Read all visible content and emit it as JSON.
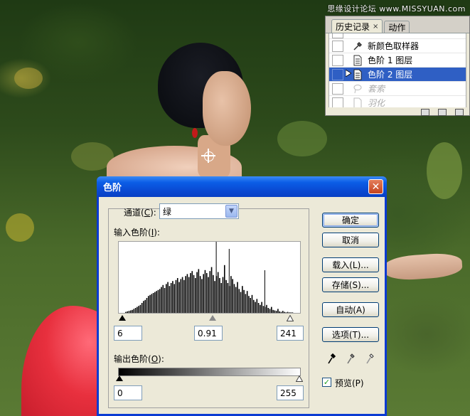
{
  "watermark": "思缘设计论坛 www.MISSYUAN.com",
  "history_panel": {
    "tabs": [
      {
        "label": "历史记录",
        "close": "×"
      },
      {
        "label": "动作"
      }
    ],
    "items": [
      {
        "label": "新颜色取样器"
      },
      {
        "label": "色阶 1 图层"
      },
      {
        "label": "色阶 2 图层"
      },
      {
        "label": "套索"
      },
      {
        "label": "羽化"
      }
    ]
  },
  "dialog": {
    "title": "色阶",
    "close": "✕",
    "channel_label_pre": "通道(",
    "channel_label_key": "C",
    "channel_label_post": "):",
    "channel_value": "绿",
    "input_label_pre": "输入色阶(",
    "input_label_key": "I",
    "input_label_post": "):",
    "input_black": "6",
    "input_gamma": "0.91",
    "input_white": "241",
    "output_label_pre": "输出色阶(",
    "output_label_key": "O",
    "output_label_post": "):",
    "output_black": "0",
    "output_white": "255",
    "buttons": {
      "ok": "确定",
      "cancel": "取消",
      "load": "载入(L)...",
      "save": "存储(S)...",
      "auto": "自动(A)",
      "options": "选项(T)..."
    },
    "preview_label": "预览(P)",
    "preview_checked": true
  },
  "histogram": {
    "bins": [
      0,
      0,
      0,
      0,
      2,
      3,
      4,
      5,
      6,
      8,
      10,
      12,
      14,
      16,
      20,
      24,
      26,
      30,
      34,
      36,
      38,
      40,
      42,
      44,
      46,
      48,
      52,
      56,
      50,
      58,
      62,
      54,
      60,
      64,
      58,
      66,
      70,
      62,
      68,
      72,
      66,
      74,
      78,
      72,
      80,
      84,
      76,
      70,
      82,
      88,
      74,
      68,
      78,
      86,
      80,
      72,
      84,
      92,
      76,
      64,
      74,
      82,
      70,
      60,
      72,
      96,
      66,
      60,
      54,
      74,
      68,
      58,
      52,
      62,
      48,
      42,
      54,
      46,
      38,
      44,
      34,
      30,
      36,
      26,
      22,
      28,
      20,
      16,
      22,
      14,
      12,
      16,
      10,
      8,
      12,
      6,
      5,
      4,
      8,
      3,
      2,
      4,
      2,
      1,
      2,
      1,
      1,
      1,
      0,
      0,
      0,
      0
    ],
    "spikes": [
      {
        "bin": 60,
        "value": 100
      },
      {
        "bin": 68,
        "value": 90
      },
      {
        "bin": 90,
        "value": 60
      }
    ]
  }
}
